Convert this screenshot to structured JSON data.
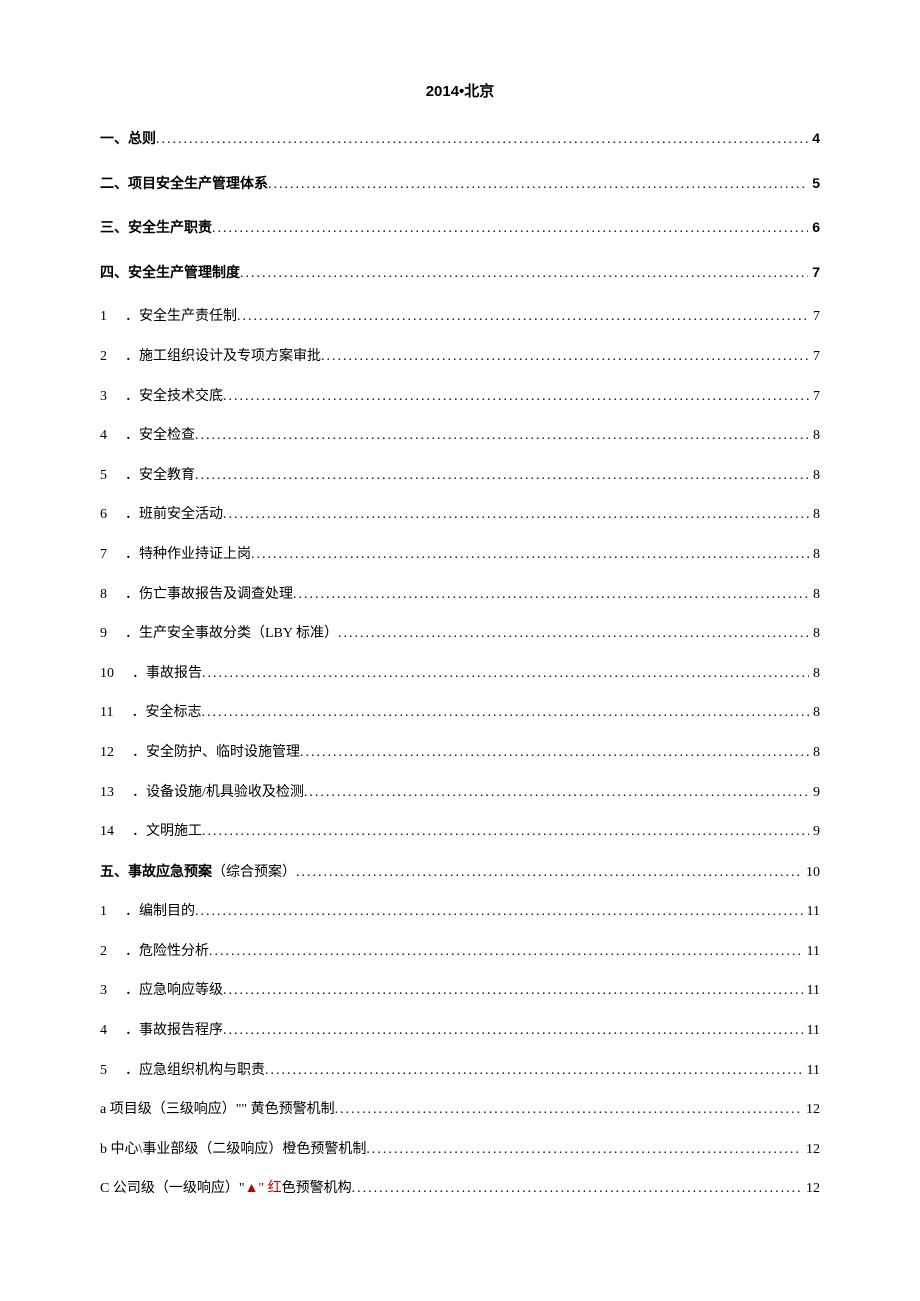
{
  "header": "2014•北京",
  "toc": [
    {
      "type": "major",
      "label": "一、总则",
      "page": "4"
    },
    {
      "type": "major",
      "label": "二、项目安全生产管理体系",
      "page": "5"
    },
    {
      "type": "major",
      "label": "三、安全生产职责",
      "page": "6"
    },
    {
      "type": "major",
      "label": "四、安全生产管理制度",
      "page": "7"
    },
    {
      "type": "item",
      "num": "1",
      "label": "．安全生产责任制",
      "page": "7"
    },
    {
      "type": "item",
      "num": "2",
      "label": "．施工组织设计及专项方案审批",
      "page": "7"
    },
    {
      "type": "item",
      "num": "3",
      "label": "．安全技术交底",
      "page": "7"
    },
    {
      "type": "item",
      "num": "4",
      "label": "．安全检查",
      "page": "8"
    },
    {
      "type": "item",
      "num": "5",
      "label": "．安全教育",
      "page": "8"
    },
    {
      "type": "item",
      "num": "6",
      "label": "．班前安全活动",
      "page": "8"
    },
    {
      "type": "item",
      "num": "7",
      "label": "．特种作业持证上岗",
      "page": "8"
    },
    {
      "type": "item",
      "num": "8",
      "label": "．伤亡事故报告及调查处理",
      "page": "8"
    },
    {
      "type": "item",
      "num": "9",
      "label": "．生产安全事故分类（LBY 标准）",
      "page": "8"
    },
    {
      "type": "item",
      "num": "10",
      "label": "．事故报告",
      "page": "8"
    },
    {
      "type": "item",
      "num": "11",
      "label": "．安全标志",
      "page": "8"
    },
    {
      "type": "item",
      "num": "12",
      "label": "．安全防护、临时设施管理",
      "page": "8"
    },
    {
      "type": "item",
      "num": "13",
      "label": "．设备设施/机具验收及检测",
      "page": "9"
    },
    {
      "type": "item",
      "num": "14",
      "label": "．文明施工",
      "page": "9"
    },
    {
      "type": "minor-bold",
      "bold": "五、事故应急预案",
      "rest": "（综合预案）",
      "page": "10"
    },
    {
      "type": "item",
      "num": "1",
      "label": "．编制目的",
      "page": "11"
    },
    {
      "type": "item",
      "num": "2",
      "label": "．危险性分析",
      "page": "11"
    },
    {
      "type": "item",
      "num": "3",
      "label": "．应急响应等级",
      "page": "11"
    },
    {
      "type": "item",
      "num": "4",
      "label": "．事故报告程序",
      "page": "11"
    },
    {
      "type": "item",
      "num": "5",
      "label": "．应急组织机构与职责",
      "page": "11"
    },
    {
      "type": "plain",
      "label": "a 项目级（三级响应）\"\" 黄色预警机制",
      "page": "12"
    },
    {
      "type": "plain",
      "label": "b 中心\\事业部级（二级响应）橙色预警机制",
      "page": "12"
    },
    {
      "type": "red",
      "prefix": "C 公司级（一级响应）\"",
      "red": "▲\" 红",
      "suffix": "色预警机构",
      "page": "12"
    }
  ]
}
